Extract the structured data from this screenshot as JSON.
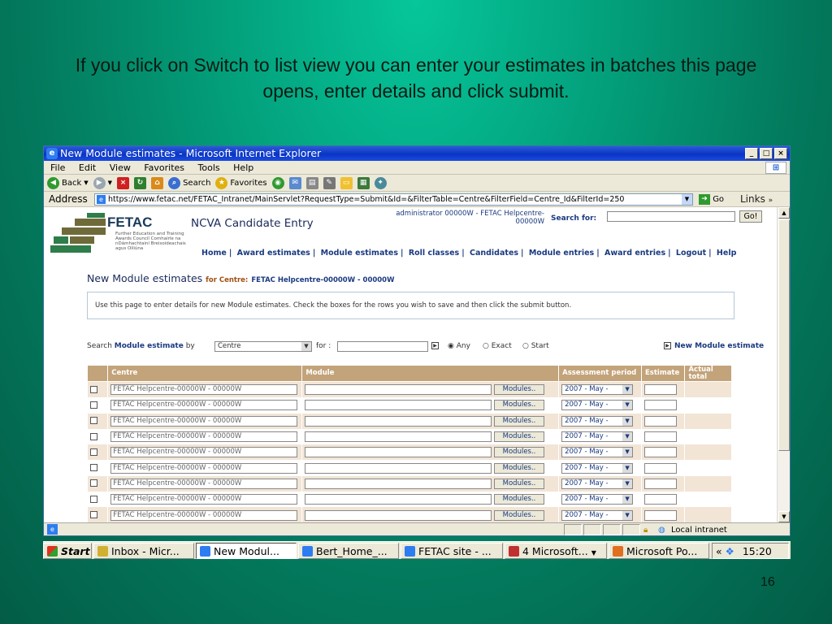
{
  "slide": {
    "title": "If you click on Switch to list view you can enter your estimates in batches this page opens, enter details and click submit.",
    "page_number": "16"
  },
  "window": {
    "title": "New Module estimates - Microsoft Internet Explorer",
    "menu": [
      "File",
      "Edit",
      "View",
      "Favorites",
      "Tools",
      "Help"
    ],
    "toolbar": {
      "back": "Back",
      "search": "Search",
      "favorites": "Favorites"
    },
    "address_label": "Address",
    "url": "https://www.fetac.net/FETAC_Intranet/MainServlet?RequestType=Submit&Id=&FilterTable=Centre&FilterField=Centre_Id&FilterId=250",
    "go_label": "Go",
    "links_label": "Links",
    "status_zone": "Local intranet"
  },
  "page": {
    "logo_text": "FETAC",
    "logo_sub": "Further Education and Training Awards Council Comhairle na nDámhachtainí Breisoideachais agus Oiliúna",
    "app_title": "NCVA Candidate Entry",
    "admin_line1": "administrator  00000W - FETAC Helpcentre-",
    "admin_line2": "00000W",
    "search_label": "Search for:",
    "search_go": "Go!",
    "nav": [
      "Home",
      "Award estimates",
      "Module estimates",
      "Roll classes",
      "Candidates",
      "Module entries",
      "Award entries",
      "Logout",
      "Help"
    ],
    "page_title": "New Module estimates",
    "for_centre_label": "for Centre:",
    "centre_name": "FETAC Helpcentre-00000W - 00000W",
    "info_text": "Use this page to enter details for new Module estimates. Check the boxes for the rows you wish to save and then click the submit button.",
    "search_row": {
      "search_word": "Search",
      "entity": "Module estimate",
      "by_word": "by",
      "by_value": "Centre",
      "for_word": "for :",
      "opt_any": "Any",
      "opt_exact": "Exact",
      "opt_start": "Start",
      "new_link": "New Module estimate"
    },
    "table": {
      "headers": [
        "Centre",
        "Module",
        "Assessment period",
        "Estimate",
        "Actual total"
      ],
      "rows": [
        {
          "centre": "FETAC Helpcentre-00000W - 00000W",
          "modules_btn": "Modules..",
          "period": "2007 - May -"
        },
        {
          "centre": "FETAC Helpcentre-00000W - 00000W",
          "modules_btn": "Modules..",
          "period": "2007 - May -"
        },
        {
          "centre": "FETAC Helpcentre-00000W - 00000W",
          "modules_btn": "Modules..",
          "period": "2007 - May -"
        },
        {
          "centre": "FETAC Helpcentre-00000W - 00000W",
          "modules_btn": "Modules..",
          "period": "2007 - May -"
        },
        {
          "centre": "FETAC Helpcentre-00000W - 00000W",
          "modules_btn": "Modules..",
          "period": "2007 - May -"
        },
        {
          "centre": "FETAC Helpcentre-00000W - 00000W",
          "modules_btn": "Modules..",
          "period": "2007 - May -"
        },
        {
          "centre": "FETAC Helpcentre-00000W - 00000W",
          "modules_btn": "Modules..",
          "period": "2007 - May -"
        },
        {
          "centre": "FETAC Helpcentre-00000W - 00000W",
          "modules_btn": "Modules..",
          "period": "2007 - May -"
        },
        {
          "centre": "FETAC Helpcentre-00000W - 00000W",
          "modules_btn": "Modules..",
          "period": "2007 - May -"
        }
      ]
    }
  },
  "taskbar": {
    "start": "Start",
    "items": [
      "Inbox - Micr...",
      "New Modul...",
      "Bert_Home_...",
      "FETAC site - ...",
      "4 Microsoft...",
      "Microsoft Po..."
    ],
    "clock": "15:20"
  }
}
